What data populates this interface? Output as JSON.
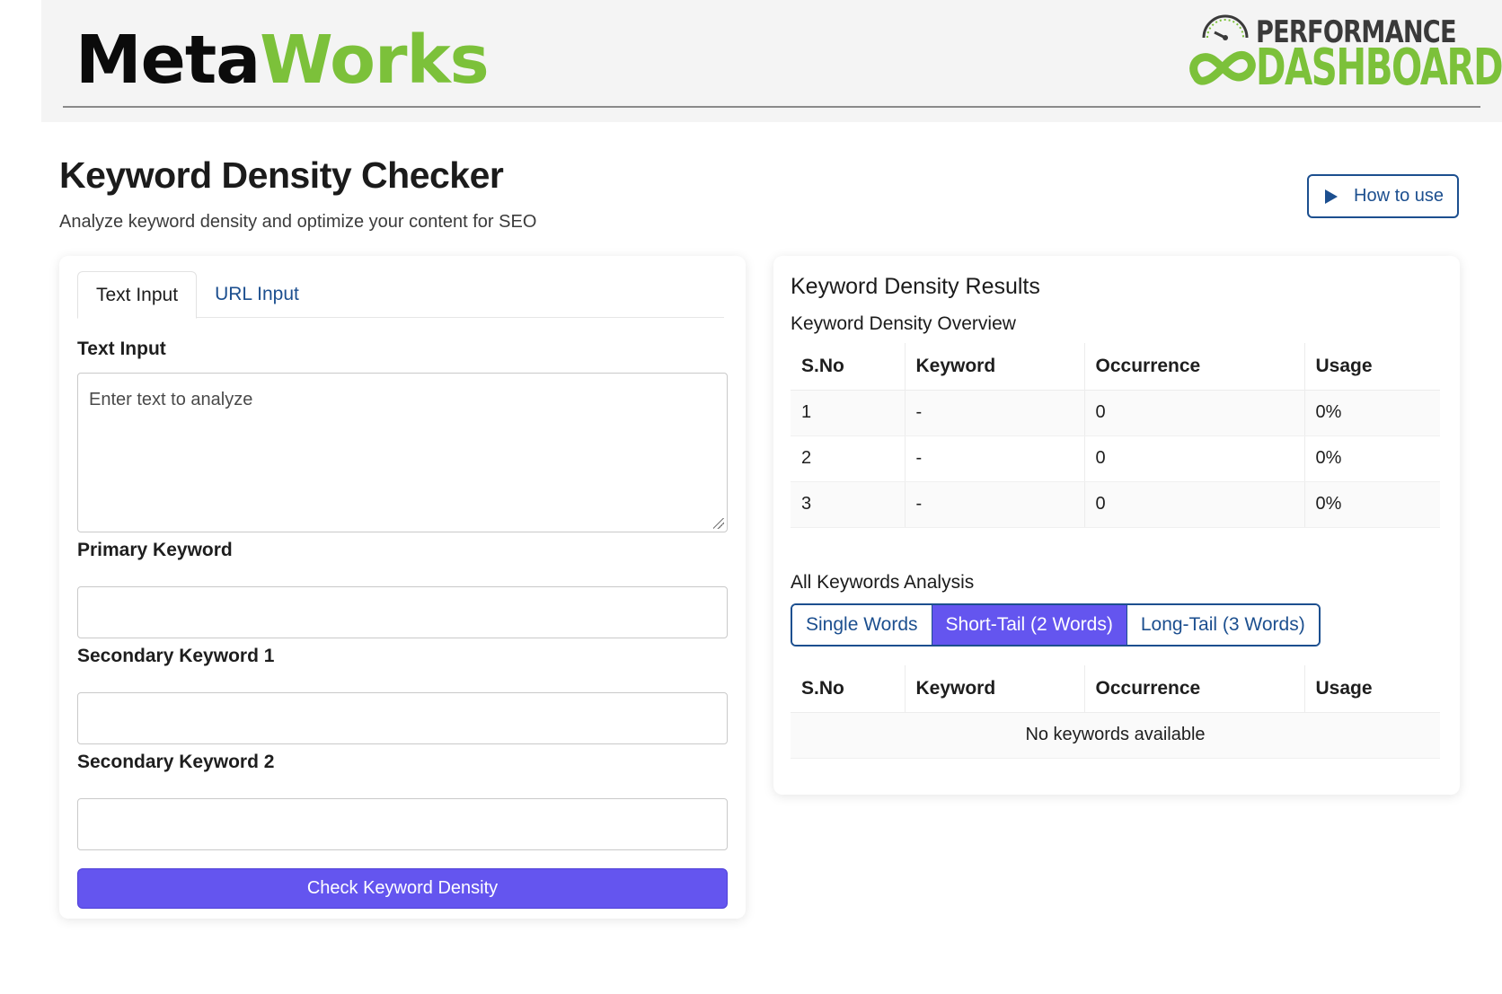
{
  "brand": {
    "logo_meta": "Meta",
    "logo_works": "Works",
    "perf_top": "PERFORMANCE",
    "perf_bottom": "DASHBOARD",
    "colors": {
      "green": "#7cc13a",
      "accent": "#6455ef",
      "link": "#1c4f8f"
    }
  },
  "page": {
    "title": "Keyword Density Checker",
    "subtitle": "Analyze keyword density and optimize your content for SEO",
    "how_to_use": "How to use"
  },
  "left": {
    "tabs": [
      {
        "label": "Text Input",
        "active": true
      },
      {
        "label": "URL Input",
        "active": false
      }
    ],
    "text_input_label": "Text Input",
    "text_input_placeholder": "Enter text to analyze",
    "primary_label": "Primary Keyword",
    "secondary1_label": "Secondary Keyword 1",
    "secondary2_label": "Secondary Keyword 2",
    "submit_label": "Check Keyword Density"
  },
  "right": {
    "title": "Keyword Density Results",
    "overview_label": "Keyword Density Overview",
    "columns": [
      "S.No",
      "Keyword",
      "Occurrence",
      "Usage"
    ],
    "rows": [
      {
        "sno": "1",
        "keyword": "-",
        "occurrence": "0",
        "usage": "0%"
      },
      {
        "sno": "2",
        "keyword": "-",
        "occurrence": "0",
        "usage": "0%"
      },
      {
        "sno": "3",
        "keyword": "-",
        "occurrence": "0",
        "usage": "0%"
      }
    ],
    "analysis_label": "All Keywords Analysis",
    "segments": [
      {
        "label": "Single Words",
        "active": false
      },
      {
        "label": "Short-Tail (2 Words)",
        "active": true
      },
      {
        "label": "Long-Tail (3 Words)",
        "active": false
      }
    ],
    "empty_message": "No keywords available"
  }
}
